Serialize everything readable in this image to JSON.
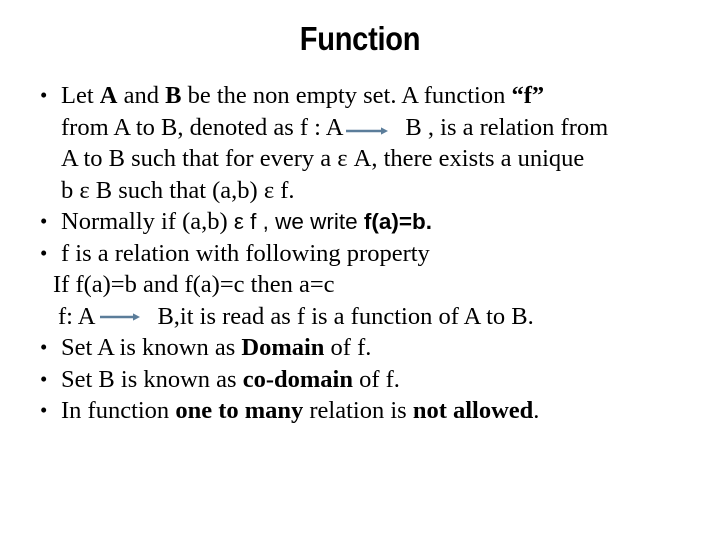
{
  "slide": {
    "title": "Function",
    "background_color": "#ffffff",
    "text_color": "#000000",
    "arrow_color": "#5b7d9a",
    "bullet_glyph": "•"
  },
  "content": {
    "bullet1": {
      "line1_a": "Let ",
      "line1_b1": "A",
      "line1_c": " and ",
      "line1_b2": "B",
      "line1_d": " be the non empty set. A function ",
      "line1_b3": "“f”",
      "line2_a": "from A to B, denoted as f : A",
      "line2_b": "B , is a relation from",
      "line3": "A to B such that for every a ε A, there exists a unique",
      "line4": "b ε B such that (a,b) ε f."
    },
    "bullet2": {
      "a": "Normally if (a,b) ",
      "b": "ε",
      "c": " f , we write ",
      "d": "f(a)=b."
    },
    "bullet3": {
      "text": "f is a relation with following property"
    },
    "sub1": {
      "text": "If f(a)=b  and f(a)=c then a=c"
    },
    "sub2": {
      "a": "f: A",
      "b": "B,it is read as f is a function of A to B."
    },
    "bullet4": {
      "a": "Set A is known as ",
      "b": "Domain",
      "c": " of f."
    },
    "bullet5": {
      "a": "Set B is known as ",
      "b": "co-domain",
      "c": " of f."
    },
    "bullet6": {
      "a": "In function ",
      "b": "one to many",
      "c": " relation is ",
      "d": "not allowed",
      "e": "."
    }
  }
}
